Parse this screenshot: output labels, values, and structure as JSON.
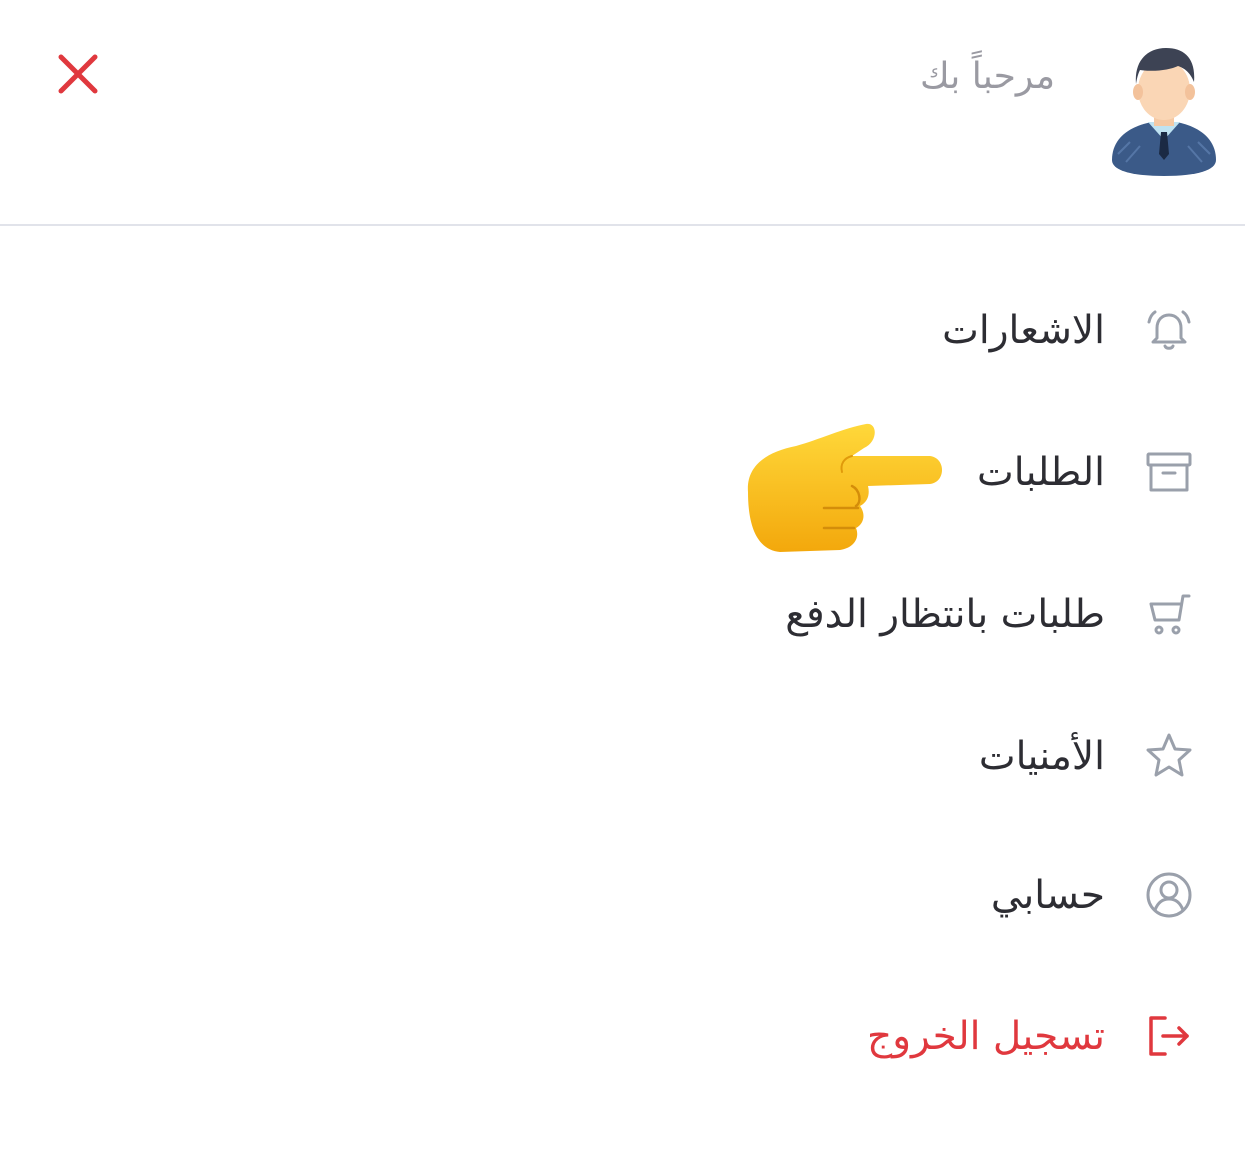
{
  "header": {
    "greeting": "مرحباً بك",
    "close_icon": "close-icon",
    "avatar_icon": "user-avatar",
    "accent_color": "#e0383e"
  },
  "menu": {
    "items": [
      {
        "label": "الاشعارات",
        "icon": "bell-icon"
      },
      {
        "label": "الطلبات",
        "icon": "archive-box-icon"
      },
      {
        "label": "طلبات بانتظار الدفع",
        "icon": "cart-icon"
      },
      {
        "label": "الأمنيات",
        "icon": "star-icon"
      },
      {
        "label": "حسابي",
        "icon": "user-circle-icon"
      },
      {
        "label": "تسجيل الخروج",
        "icon": "logout-icon",
        "color": "#e0383e"
      }
    ]
  },
  "overlay": {
    "pointer_icon": "pointing-hand-emoji"
  }
}
